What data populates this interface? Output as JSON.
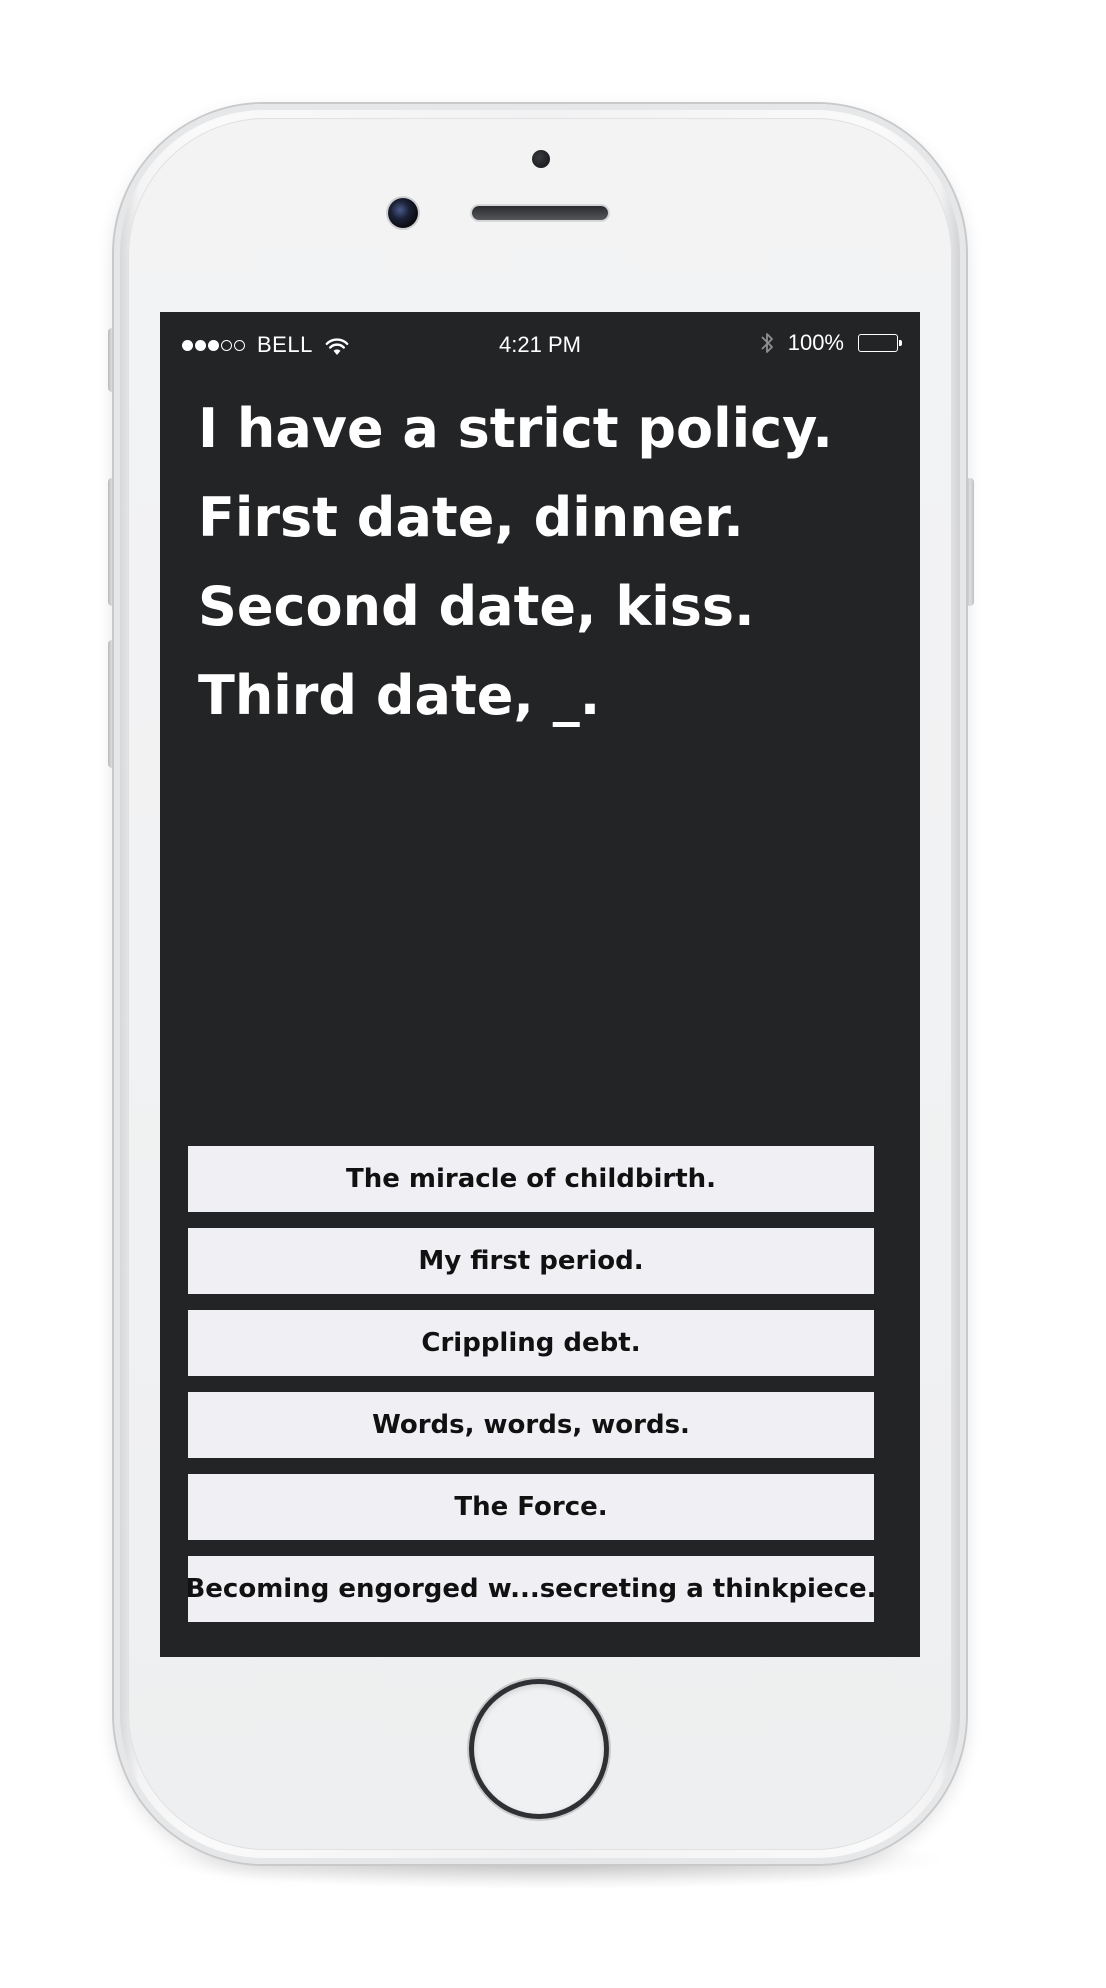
{
  "status_bar": {
    "signal_filled": 3,
    "signal_total": 5,
    "carrier": "BELL",
    "time": "4:21 PM",
    "battery": "100%",
    "icons": [
      "wifi-icon",
      "bluetooth-icon",
      "battery-icon"
    ]
  },
  "prompt": {
    "text": "I have a strict policy. First date, dinner. Second date, kiss. Third date, _."
  },
  "answers": [
    "The miracle of childbirth.",
    "My first period.",
    "Crippling debt.",
    "Words, words, words.",
    "The Force.",
    "Becoming engorged w...secreting a thinkpiece."
  ],
  "colors": {
    "screen_background": "#232426",
    "answer_background": "#efeff4",
    "answer_text": "#111111",
    "prompt_text": "#ffffff"
  }
}
